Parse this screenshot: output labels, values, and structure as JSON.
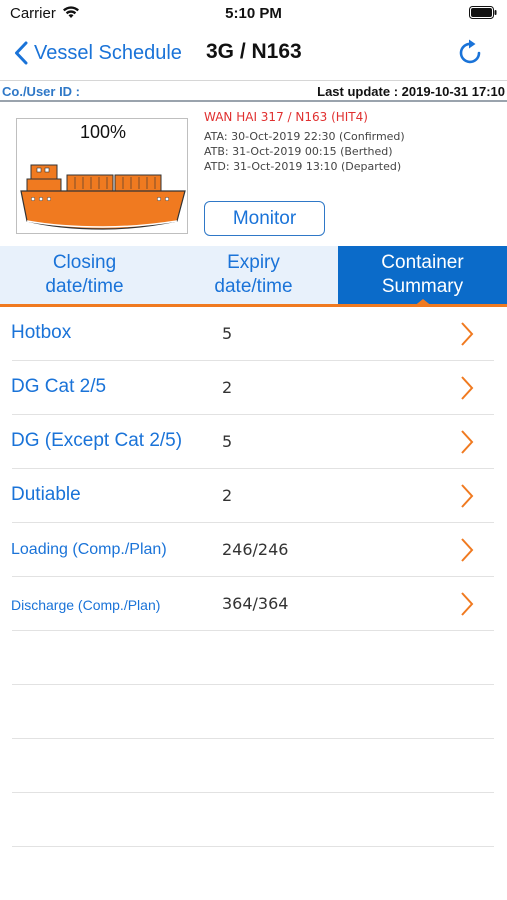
{
  "status_bar": {
    "carrier": "Carrier",
    "time": "5:10 PM"
  },
  "nav": {
    "back_label": "Vessel Schedule",
    "title": "3G / N163"
  },
  "info": {
    "user_id_label": "Co./User ID :",
    "last_update": "Last update : 2019-10-31 17:10"
  },
  "vessel": {
    "progress_label": "100%",
    "progress_value": 1.0,
    "name": "WAN HAI 317 / N163 (HIT4)",
    "ata": "ATA: 30-Oct-2019 22:30 (Confirmed)",
    "atb": "ATB: 31-Oct-2019 00:15 (Berthed)",
    "atd": "ATD: 31-Oct-2019 13:10 (Departed)",
    "monitor_label": "Monitor"
  },
  "tabs": [
    {
      "label": "Closing\ndate/time",
      "active": false
    },
    {
      "label": "Expiry\ndate/time",
      "active": false
    },
    {
      "label": "Container\nSummary",
      "active": true
    }
  ],
  "summary": [
    {
      "label": "Hotbox",
      "value": "5"
    },
    {
      "label": "DG Cat 2/5",
      "value": "2"
    },
    {
      "label": "DG (Except Cat 2/5)",
      "value": "5"
    },
    {
      "label": "Dutiable",
      "value": "2"
    },
    {
      "label": "Loading (Comp./Plan)",
      "value": "246/246"
    },
    {
      "label": "Discharge (Comp./Plan)",
      "value": "364/364"
    }
  ],
  "icons": {
    "wifi": "wifi-icon",
    "battery": "battery-icon",
    "back": "chevron-left-icon",
    "refresh": "refresh-icon",
    "ship": "ship-icon",
    "row_chevron": "chevron-right-icon"
  },
  "colors": {
    "accent": "#1a73d8",
    "active_tab": "#0b6bc9",
    "tab_background": "#e8f1fb",
    "orange": "#f07a20",
    "vessel_name": "#e03030"
  }
}
